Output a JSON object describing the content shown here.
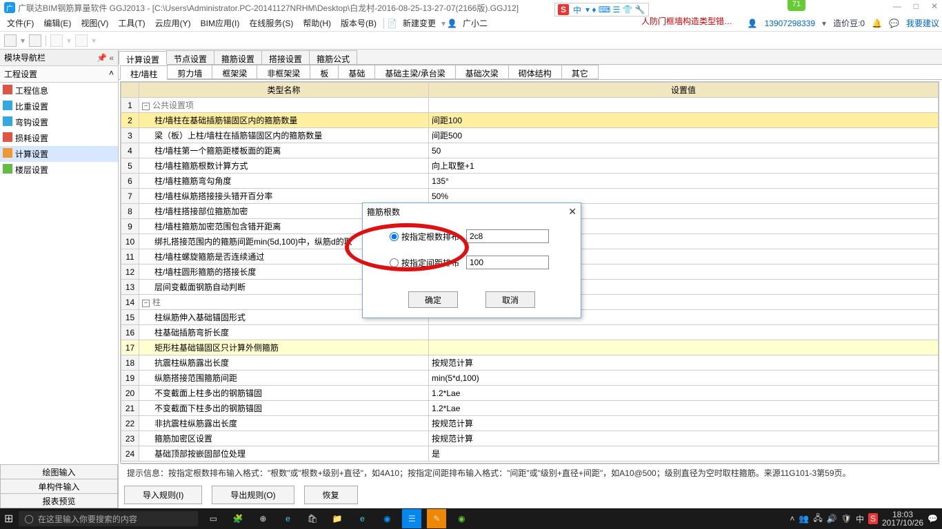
{
  "titlebar": {
    "app_icon": "广",
    "title": "广联达BIM钢筋算量软件 GGJ2013 - [C:\\Users\\Administrator.PC-20141127NRHM\\Desktop\\白龙村-2016-08-25-13-27-07(2166版).GGJ12]"
  },
  "win_controls": {
    "min": "—",
    "max": "□",
    "close": "✕"
  },
  "ime": {
    "label": "中",
    "items": "▾ ♦ ⌨ ☰ 👕 🔧"
  },
  "green_badge": "71",
  "menubar": {
    "items": [
      "文件(F)",
      "编辑(E)",
      "视图(V)",
      "工具(T)",
      "云应用(Y)",
      "BIM应用(I)",
      "在线服务(S)",
      "帮助(H)",
      "版本号(B)"
    ],
    "new_change": "新建变更",
    "user_small": "广小二",
    "truncate": "人防门框墙构造类型错…",
    "right_user": "13907298339",
    "beans": "造价豆:0",
    "feedback": "我要建议"
  },
  "sidebar": {
    "panel_title": "模块导航栏",
    "sub_title": "工程设置",
    "items": [
      {
        "label": "工程信息"
      },
      {
        "label": "比重设置"
      },
      {
        "label": "弯钩设置"
      },
      {
        "label": "损耗设置"
      },
      {
        "label": "计算设置",
        "selected": true
      },
      {
        "label": "楼层设置"
      }
    ],
    "bottom": [
      "绘图输入",
      "单构件输入",
      "报表预览"
    ]
  },
  "tabs": [
    "计算设置",
    "节点设置",
    "箍筋设置",
    "搭接设置",
    "箍筋公式"
  ],
  "subtabs": [
    "柱/墙柱",
    "剪力墙",
    "框架梁",
    "非框架梁",
    "板",
    "基础",
    "基础主梁/承台梁",
    "基础次梁",
    "砌体结构",
    "其它"
  ],
  "grid": {
    "headers": [
      "类型名称",
      "设置值"
    ],
    "rows": [
      {
        "n": 1,
        "cat": true,
        "name": "公共设置项",
        "val": ""
      },
      {
        "n": 2,
        "sel": true,
        "name": "柱/墙柱在基础插筋锚固区内的箍筋数量",
        "val": "间距100"
      },
      {
        "n": 3,
        "name": "梁（板）上柱/墙柱在插筋锚固区内的箍筋数量",
        "val": "间距500"
      },
      {
        "n": 4,
        "name": "柱/墙柱第一个箍筋距楼板面的距离",
        "val": "50"
      },
      {
        "n": 5,
        "name": "柱/墙柱箍筋根数计算方式",
        "val": "向上取整+1"
      },
      {
        "n": 6,
        "name": "柱/墙柱箍筋弯勾角度",
        "val": "135°"
      },
      {
        "n": 7,
        "name": "柱/墙柱纵筋搭接接头错开百分率",
        "val": "50%"
      },
      {
        "n": 8,
        "name": "柱/墙柱搭接部位箍筋加密",
        "val": ""
      },
      {
        "n": 9,
        "name": "柱/墙柱箍筋加密范围包含错开距离",
        "val": ""
      },
      {
        "n": 10,
        "name": "绑扎搭接范围内的箍筋间距min(5d,100)中，纵筋d的取",
        "val": ""
      },
      {
        "n": 11,
        "name": "柱/墙柱螺旋箍筋是否连续通过",
        "val": ""
      },
      {
        "n": 12,
        "name": "柱/墙柱圆形箍筋的搭接长度",
        "val": ""
      },
      {
        "n": 13,
        "name": "层间变截面钢筋自动判断",
        "val": ""
      },
      {
        "n": 14,
        "cat": true,
        "name": "柱",
        "val": ""
      },
      {
        "n": 15,
        "name": "柱纵筋伸入基础锚固形式",
        "val": ""
      },
      {
        "n": 16,
        "name": "柱基础插筋弯折长度",
        "val": ""
      },
      {
        "n": 17,
        "hl": true,
        "name": "矩形柱基础锚固区只计算外侧箍筋",
        "val": ""
      },
      {
        "n": 18,
        "name": "抗震柱纵筋露出长度",
        "val": "按规范计算"
      },
      {
        "n": 19,
        "name": "纵筋搭接范围箍筋间距",
        "val": "min(5*d,100)"
      },
      {
        "n": 20,
        "name": "不变截面上柱多出的钢筋锚固",
        "val": "1.2*Lae"
      },
      {
        "n": 21,
        "name": "不变截面下柱多出的钢筋锚固",
        "val": "1.2*Lae"
      },
      {
        "n": 22,
        "name": "非抗震柱纵筋露出长度",
        "val": "按规范计算"
      },
      {
        "n": 23,
        "name": "箍筋加密区设置",
        "val": "按规范计算"
      },
      {
        "n": 24,
        "name": "基础顶部按嵌固部位处理",
        "val": "是"
      }
    ]
  },
  "hint": "提示信息：按指定根数排布输入格式：\"根数\"或\"根数+级别+直径\"，如4A10；按指定间距排布输入格式：\"间距\"或\"级别+直径+间距\"，如A10@500；级别直径为空时取柱箍筋。来源11G101-3第59页。",
  "bottom_buttons": [
    "导入规则(I)",
    "导出规则(O)",
    "恢复"
  ],
  "dialog": {
    "title": "箍筋根数",
    "opt1": "按指定根数排布",
    "val1": "2c8",
    "opt2": "按指定间距排布",
    "val2": "100",
    "ok": "确定",
    "cancel": "取消"
  },
  "taskbar": {
    "search_placeholder": "在这里输入你要搜索的内容",
    "time": "18:03",
    "date": "2017/10/26"
  }
}
